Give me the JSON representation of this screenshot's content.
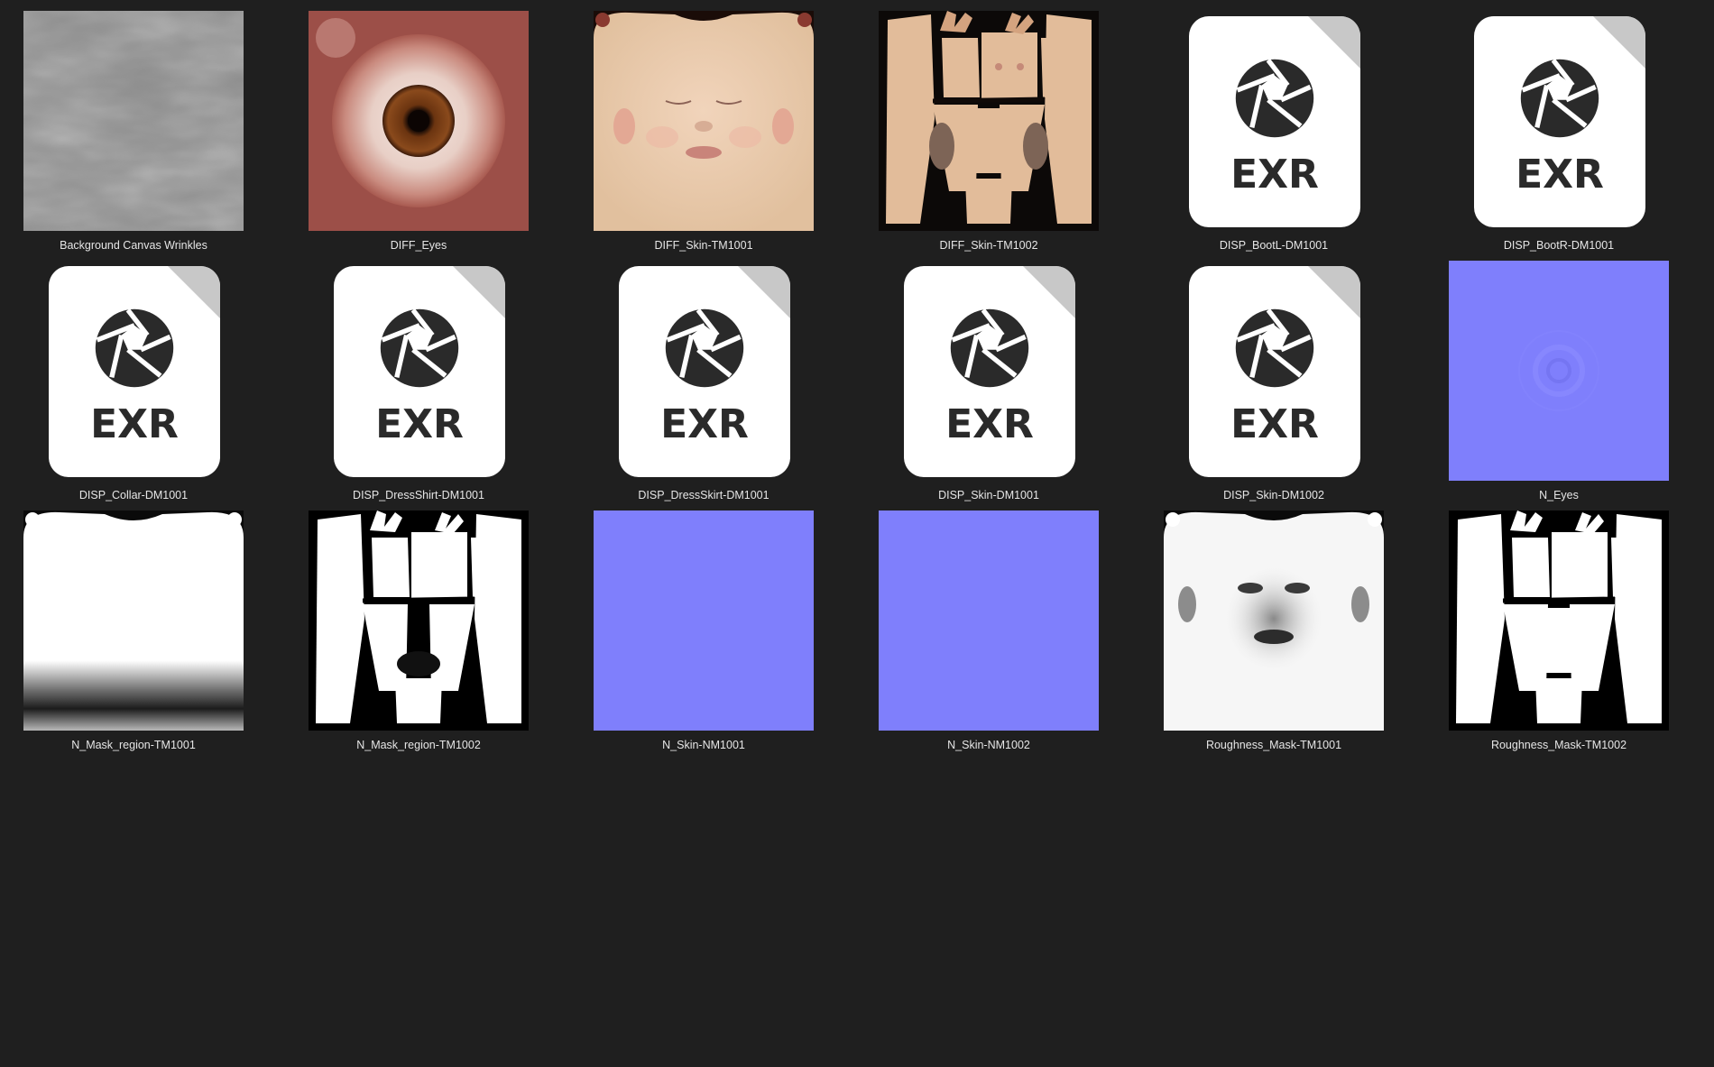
{
  "files": [
    {
      "name": "Background Canvas Wrinkles",
      "kind": "texture-wrinkles"
    },
    {
      "name": "DIFF_Eyes",
      "kind": "texture-eye"
    },
    {
      "name": "DIFF_Skin-TM1001",
      "kind": "texture-face"
    },
    {
      "name": "DIFF_Skin-TM1002",
      "kind": "texture-body"
    },
    {
      "name": "DISP_BootL-DM1001",
      "kind": "exr-icon",
      "ext": "EXR"
    },
    {
      "name": "DISP_BootR-DM1001",
      "kind": "exr-icon",
      "ext": "EXR"
    },
    {
      "name": "DISP_Collar-DM1001",
      "kind": "exr-icon",
      "ext": "EXR"
    },
    {
      "name": "DISP_DressShirt-DM1001",
      "kind": "exr-icon",
      "ext": "EXR"
    },
    {
      "name": "DISP_DressSkirt-DM1001",
      "kind": "exr-icon",
      "ext": "EXR"
    },
    {
      "name": "DISP_Skin-DM1001",
      "kind": "exr-icon",
      "ext": "EXR"
    },
    {
      "name": "DISP_Skin-DM1002",
      "kind": "exr-icon",
      "ext": "EXR"
    },
    {
      "name": "N_Eyes",
      "kind": "normal-eye"
    },
    {
      "name": "N_Mask_region-TM1001",
      "kind": "mask-face"
    },
    {
      "name": "N_Mask_region-TM1002",
      "kind": "mask-body"
    },
    {
      "name": "N_Skin-NM1001",
      "kind": "normal-flat"
    },
    {
      "name": "N_Skin-NM1002",
      "kind": "normal-flat"
    },
    {
      "name": "Roughness_Mask-TM1001",
      "kind": "roughness-face"
    },
    {
      "name": "Roughness_Mask-TM1002",
      "kind": "mask-body"
    }
  ],
  "colors": {
    "background": "#1f1f1f",
    "label": "#e6e6e6",
    "normal_map": "#8080ff",
    "exr_icon_bg": "#ffffff",
    "exr_icon_fg": "#2a2a2a"
  }
}
